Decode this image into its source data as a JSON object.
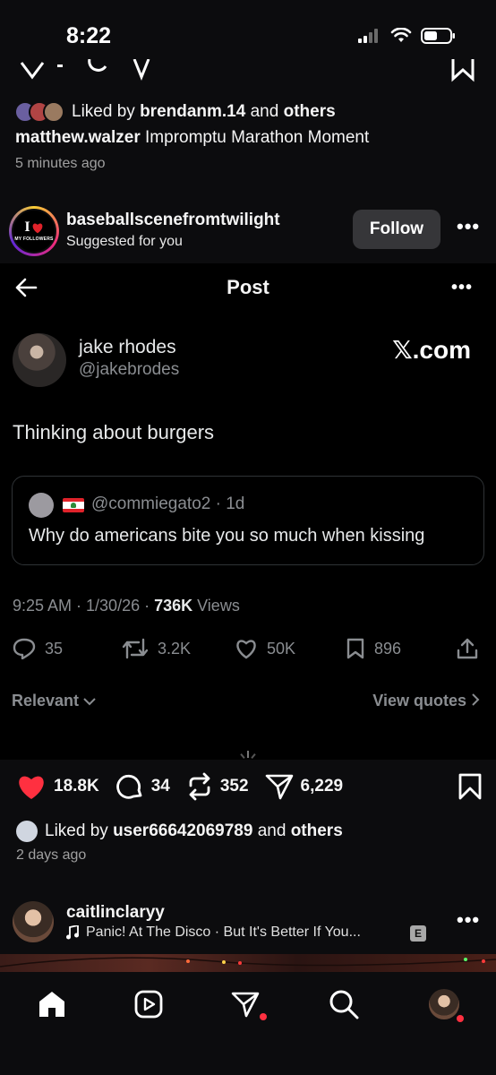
{
  "status_bar": {
    "time": "8:22"
  },
  "top_post": {
    "liked_by_prefix": "Liked by",
    "liked_by_user": "brendanm.14",
    "liked_by_and": "and",
    "liked_by_others": "others",
    "caption_user": "matthew.walzer",
    "caption_text": "Impromptu Marathon Moment",
    "time_ago": "5 minutes ago"
  },
  "suggested": {
    "avatar_text_big": "I",
    "avatar_text_small": "MY FOLLOWERS",
    "username": "baseballscenefromtwilight",
    "subtitle": "Suggested for you",
    "follow_label": "Follow",
    "more_label": "•••"
  },
  "x_post": {
    "header_title": "Post",
    "more_label": "•••",
    "author_name": "jake rhodes",
    "author_handle": "@jakebrodes",
    "brand": "𝕏.com",
    "body": "Thinking about burgers",
    "quote": {
      "handle_time": "@commiegato2 · 1d",
      "text": "Why do americans bite you so much when kissing"
    },
    "meta_time": "9:25 AM · 1/30/26 · ",
    "meta_views_count": "736K",
    "meta_views_label": " Views",
    "actions": {
      "replies": "35",
      "reposts": "3.2K",
      "likes": "50K",
      "bookmarks": "896"
    },
    "relevant_label": "Relevant",
    "view_quotes_label": "View quotes"
  },
  "ig_actions": {
    "likes": "18.8K",
    "comments": "34",
    "reposts": "352",
    "shares": "6,229"
  },
  "liked_by_bottom": {
    "prefix": "Liked by",
    "user": "user66642069789",
    "and": "and",
    "others": "others",
    "time_ago": "2 days ago"
  },
  "next_post": {
    "username": "caitlinclaryy",
    "song": "Panic! At The Disco · But It's Better If You...",
    "explicit_badge": "E",
    "more_label": "•••"
  },
  "colors": {
    "like_red": "#ff3040",
    "background": "#0c0c0e",
    "x_background": "#000000"
  },
  "icons": [
    "home-icon",
    "reels-icon",
    "messages-icon",
    "search-icon",
    "profile-avatar"
  ]
}
